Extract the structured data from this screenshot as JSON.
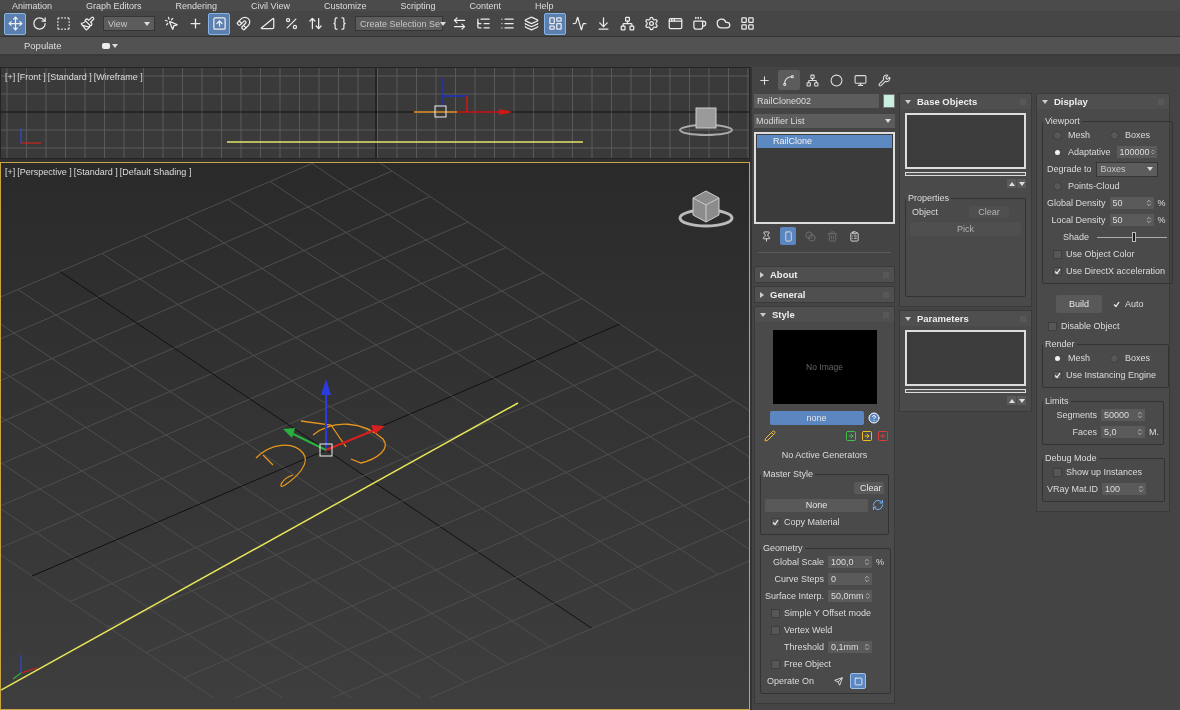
{
  "menu": [
    "Animation",
    "Graph Editors",
    "Rendering",
    "Civil View",
    "Customize",
    "Scripting",
    "Content",
    "Help"
  ],
  "toolbar": [
    {
      "kind": "button",
      "selected": true
    },
    {
      "kind": "button",
      "selected": false
    },
    {
      "kind": "button",
      "selected": false
    },
    {
      "kind": "button",
      "selected": false
    },
    {
      "kind": "dropdown",
      "value": "View"
    },
    {
      "kind": "button",
      "selected": false
    },
    {
      "kind": "button",
      "selected": false
    },
    {
      "kind": "button",
      "selected": true
    },
    {
      "kind": "button",
      "selected": false
    },
    {
      "kind": "button",
      "selected": false
    },
    {
      "kind": "button",
      "selected": false
    },
    {
      "kind": "button",
      "selected": false
    },
    {
      "kind": "button",
      "selected": false
    },
    {
      "kind": "dropdown",
      "value": "Create Selection Se"
    },
    {
      "kind": "button",
      "selected": false
    },
    {
      "kind": "button",
      "selected": false
    },
    {
      "kind": "button",
      "selected": false
    },
    {
      "kind": "button",
      "selected": false
    },
    {
      "kind": "button",
      "selected": true
    },
    {
      "kind": "button",
      "selected": false
    },
    {
      "kind": "button",
      "selected": false
    },
    {
      "kind": "button",
      "selected": false
    },
    {
      "kind": "button",
      "selected": false
    },
    {
      "kind": "button",
      "selected": false
    },
    {
      "kind": "button",
      "selected": false
    },
    {
      "kind": "button",
      "selected": false
    },
    {
      "kind": "button",
      "selected": false
    }
  ],
  "ribbon": {
    "tab": "Populate"
  },
  "viewports": [
    {
      "kind": "front",
      "active": false,
      "labels": [
        "[+]",
        "[Front ]",
        "[Standard ]",
        "[Wireframe ]"
      ]
    },
    {
      "kind": "perspective",
      "active": true,
      "labels": [
        "[+]",
        "[Perspective ]",
        "[Standard ]",
        "[Default Shading ]"
      ]
    }
  ],
  "command_panel": {
    "tabs": [
      {
        "selected": false
      },
      {
        "selected": true
      },
      {
        "selected": false
      },
      {
        "selected": false
      },
      {
        "selected": false
      },
      {
        "selected": false
      }
    ],
    "object_name": "RailClone002",
    "modifier_list": "Modifier List",
    "stack": [
      {
        "label": "RailClone",
        "selected": true
      }
    ],
    "stack_tools": [
      {
        "selected": false,
        "disabled": false
      },
      {
        "selected": true,
        "disabled": false
      },
      {
        "selected": false,
        "disabled": true
      },
      {
        "selected": false,
        "disabled": true
      },
      {
        "selected": false,
        "disabled": false
      }
    ],
    "columns": [
      {
        "rollouts": [
          {
            "title": "About",
            "expanded": false
          },
          {
            "title": "General",
            "expanded": false
          },
          {
            "title": "Style",
            "expanded": true,
            "controls": [
              {
                "kind": "preview",
                "text": "No Image"
              },
              {
                "kind": "style-button",
                "label": "none"
              },
              {
                "kind": "style-tools"
              },
              {
                "kind": "note",
                "text": "No Active Generators"
              },
              {
                "kind": "group",
                "title": "Master Style",
                "controls": [
                  {
                    "kind": "clear-row",
                    "label": "Clear",
                    "disabled": false
                  },
                  {
                    "kind": "picker",
                    "label": "None"
                  },
                  {
                    "kind": "checkbox",
                    "label": "Copy Material",
                    "checked": true
                  }
                ]
              },
              {
                "kind": "group",
                "title": "Geometry",
                "controls": [
                  {
                    "kind": "spinner",
                    "label": "Global Scale",
                    "value": "100,0",
                    "unit": "%"
                  },
                  {
                    "kind": "spinner",
                    "label": "Curve Steps",
                    "value": "0"
                  },
                  {
                    "kind": "spinner",
                    "label": "Surface Interp.",
                    "value": "50,0mm"
                  },
                  {
                    "kind": "checkbox",
                    "label": "Simple Y Offset mode",
                    "checked": false
                  },
                  {
                    "kind": "checkbox",
                    "label": "Vertex Weld",
                    "checked": false
                  },
                  {
                    "kind": "spinner",
                    "label": "Threshold",
                    "value": "0,1mm"
                  },
                  {
                    "kind": "checkbox",
                    "label": "Free Object",
                    "checked": false
                  },
                  {
                    "kind": "icon-choice",
                    "label": "Operate On",
                    "options": [
                      {
                        "selected": false
                      },
                      {
                        "selected": true
                      }
                    ]
                  }
                ]
              }
            ]
          }
        ]
      },
      {
        "rollouts": [
          {
            "title": "Base Objects",
            "expanded": true,
            "controls": [
              {
                "kind": "listbox"
              },
              {
                "kind": "group",
                "title": "Properties",
                "controls": [
                  {
                    "kind": "object-row",
                    "label": "Object",
                    "button": "Clear",
                    "disabled": true
                  },
                  {
                    "kind": "button",
                    "label": "Pick",
                    "disabled": true
                  }
                ]
              }
            ]
          },
          {
            "title": "Parameters",
            "expanded": true,
            "controls": [
              {
                "kind": "listbox"
              }
            ]
          }
        ]
      },
      {
        "rollouts": [
          {
            "title": "Display",
            "expanded": true,
            "controls": [
              {
                "kind": "group",
                "title": "Viewport",
                "controls": [
                  {
                    "kind": "radio-row",
                    "options": [
                      {
                        "label": "Mesh",
                        "selected": false
                      },
                      {
                        "label": "Boxes",
                        "selected": false
                      }
                    ]
                  },
                  {
                    "kind": "radio-row",
                    "options": [
                      {
                        "label": "Adaptative",
                        "selected": true,
                        "value": "100000"
                      }
                    ]
                  },
                  {
                    "kind": "dropdown",
                    "label": "Degrade to",
                    "value": "Boxes"
                  },
                  {
                    "kind": "radio-row",
                    "options": [
                      {
                        "label": "Points-Cloud",
                        "selected": false
                      }
                    ]
                  },
                  {
                    "kind": "spinner",
                    "label": "Global Density",
                    "value": "50",
                    "unit": "%"
                  },
                  {
                    "kind": "spinner",
                    "label": "Local Density",
                    "value": "50",
                    "unit": "%"
                  },
                  {
                    "kind": "slider",
                    "label": "Shade",
                    "level": 0.53
                  },
                  {
                    "kind": "checkbox",
                    "label": "Use Object Color",
                    "checked": false
                  },
                  {
                    "kind": "checkbox",
                    "label": "Use DirectX acceleration",
                    "checked": true
                  }
                ]
              },
              {
                "kind": "build",
                "label": "Build",
                "checkbox": {
                  "label": "Auto",
                  "checked": true
                }
              },
              {
                "kind": "checkbox",
                "label": "Disable Object",
                "checked": false
              },
              {
                "kind": "group",
                "title": "Render",
                "controls": [
                  {
                    "kind": "radio-row",
                    "options": [
                      {
                        "label": "Mesh",
                        "selected": true
                      },
                      {
                        "label": "Boxes",
                        "selected": false
                      }
                    ]
                  },
                  {
                    "kind": "checkbox",
                    "label": "Use Instancing Engine",
                    "checked": true
                  }
                ]
              },
              {
                "kind": "group",
                "title": "Limits",
                "controls": [
                  {
                    "kind": "spinner",
                    "label": "Segments",
                    "value": "50000"
                  },
                  {
                    "kind": "spinner",
                    "label": "Faces",
                    "value": "5,0",
                    "unit": "M."
                  }
                ]
              },
              {
                "kind": "group",
                "title": "Debug Mode",
                "controls": [
                  {
                    "kind": "checkbox",
                    "label": "Show up Instances",
                    "checked": false
                  },
                  {
                    "kind": "spinner",
                    "label": "VRay Mat.ID",
                    "value": "100"
                  }
                ]
              }
            ]
          }
        ]
      }
    ]
  }
}
